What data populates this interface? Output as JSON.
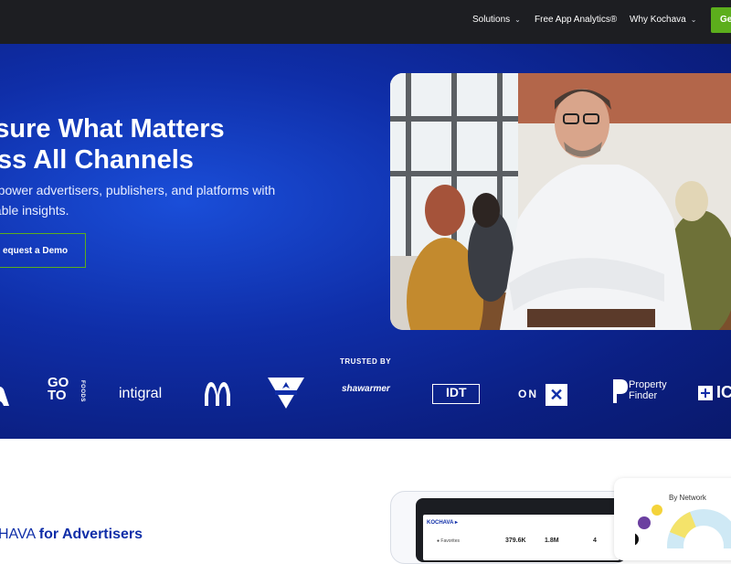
{
  "nav": {
    "solutions": "Solutions",
    "analytics": "Free App Analytics®",
    "why": "Why Kochava",
    "cta": "Ge"
  },
  "hero": {
    "headline_1": "easure What Matters",
    "headline_2": "ross All Channels",
    "subtitle_1": "mpower advertisers, publishers, and platforms with",
    "subtitle_2": "nable insights.",
    "demo_button": "equest a Demo"
  },
  "trusted": {
    "label": "TRUSTED BY",
    "logos": {
      "goto_main": "GO\nTO",
      "goto_small": "FOODS",
      "intigral": "intigral",
      "shawarmer": "shawarmer",
      "idt": "IDT",
      "onx": "ON",
      "onx_box": "✕",
      "property_finder": "Property\nFinder",
      "ic": "IC"
    }
  },
  "advertisers": {
    "prefix": "HAVA",
    "highlight": "for Advertisers"
  },
  "dashboard": {
    "brand": "KOCHAVA ▸",
    "row_label": "● Favorites",
    "value1": "379.6K",
    "value2": "1.8M",
    "value3": "4",
    "network_title": "By Network"
  },
  "colors": {
    "accent": "#5cae1c",
    "brand_blue": "#0f2ea8",
    "topbar": "#1d1e22"
  }
}
